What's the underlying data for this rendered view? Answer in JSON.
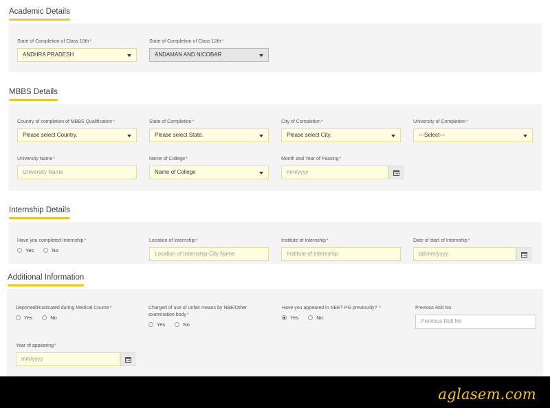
{
  "sections": {
    "academic": {
      "title": "Academic Details"
    },
    "mbbs": {
      "title": "MBBS Details"
    },
    "internship": {
      "title": "Internship Details"
    },
    "additional": {
      "title": "Additional Information"
    }
  },
  "fields": {
    "class10_state": {
      "label": "State of Completion of Class 10th",
      "value": "ANDHRA PRADESH"
    },
    "class12_state": {
      "label": "State of Completion of Class 12th",
      "value": "ANDAMAN AND NICOBAR"
    },
    "mbbs_country": {
      "label": "Country of completion of MBBS Qualification",
      "value": "Please select Country."
    },
    "mbbs_state": {
      "label": "State of Completion",
      "value": "Please select State."
    },
    "mbbs_city": {
      "label": "City of Completion",
      "value": "Please select City."
    },
    "mbbs_university": {
      "label": "University of Completion",
      "value": "---Select---"
    },
    "university_name": {
      "label": "University Name",
      "placeholder": "University Name"
    },
    "college_name": {
      "label": "Name of College",
      "value": "Name of College"
    },
    "passing_date": {
      "label": "Month and Year of Passing",
      "placeholder": "mm/yyyy"
    },
    "internship_completed": {
      "label": "Have you completed Internship",
      "options": [
        "Yes",
        "No"
      ]
    },
    "internship_location": {
      "label": "Location of Internship",
      "placeholder": "Location of Internship-City Name"
    },
    "internship_institute": {
      "label": "Institute of Internship",
      "placeholder": "Institute of Internship"
    },
    "internship_start": {
      "label": "Date of start of Internship",
      "placeholder": "dd/mm/yyyy"
    },
    "rusticated": {
      "label": "Deported/Rusticated during Medical Course",
      "options": [
        "Yes",
        "No"
      ]
    },
    "unfair_means": {
      "label": "Charged of use of unfair means by NBE/Other examination body",
      "options": [
        "Yes",
        "No"
      ]
    },
    "appeared_before": {
      "label": "Have you appeared in NEET PG previously?",
      "options": [
        "Yes",
        "No"
      ],
      "selected": "Yes"
    },
    "previous_roll": {
      "label": "Previous Roll No.",
      "placeholder": "Previous Roll No"
    },
    "year_appearing": {
      "label": "Year of appearing",
      "placeholder": "mm/yyyy"
    }
  },
  "required_mark": "*",
  "brand": {
    "text": "aglasem.com"
  },
  "colors": {
    "accent": "#f5c518",
    "input_bg": "#fffde0",
    "panel_bg": "#f4f4f4",
    "required": "#d9534f",
    "footer_bg": "#000000"
  },
  "icons": {
    "select": "chevron-down-icon",
    "date": "calendar-icon"
  }
}
